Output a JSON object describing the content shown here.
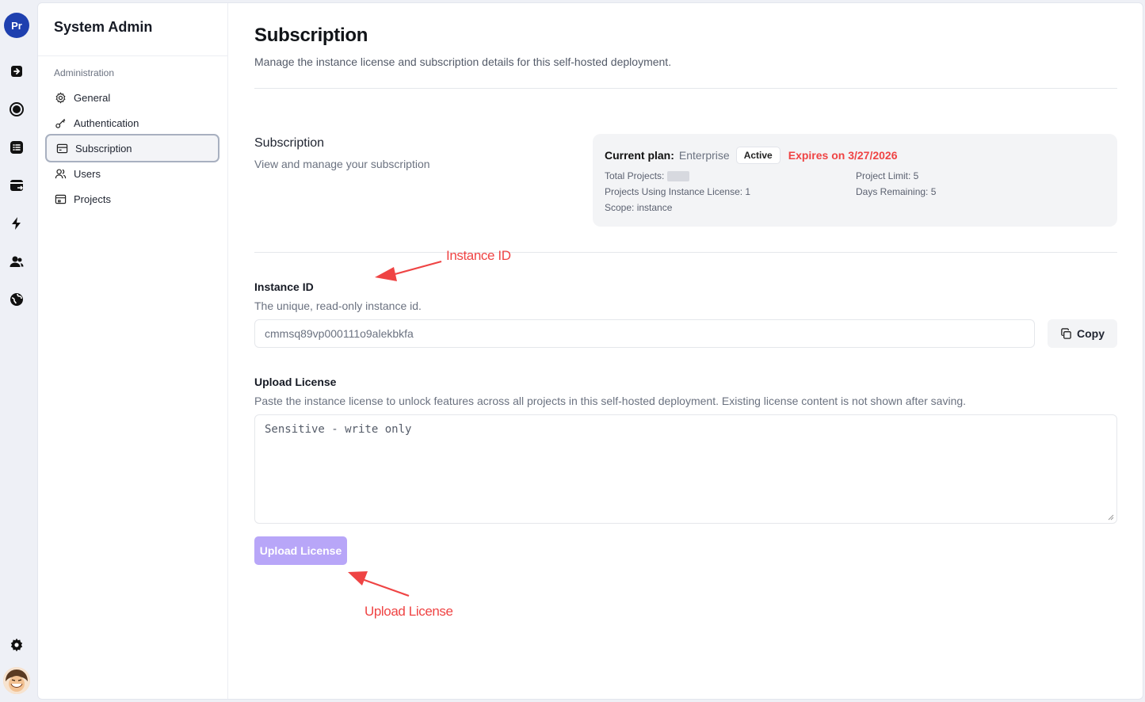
{
  "rail": {
    "workspace_initials": "Pr",
    "icons": [
      "import-icon",
      "record-icon",
      "list-icon",
      "export-icon",
      "bolt-icon",
      "team-icon",
      "globe-icon"
    ],
    "settings_icon": "gear-icon"
  },
  "sidebar": {
    "title": "System Admin",
    "section_label": "Administration",
    "items": [
      {
        "label": "General",
        "icon": "gear-icon",
        "active": false
      },
      {
        "label": "Authentication",
        "icon": "key-icon",
        "active": false
      },
      {
        "label": "Subscription",
        "icon": "card-icon",
        "active": true
      },
      {
        "label": "Users",
        "icon": "users-icon",
        "active": false
      },
      {
        "label": "Projects",
        "icon": "folder-icon",
        "active": false
      }
    ]
  },
  "page": {
    "title": "Subscription",
    "description": "Manage the instance license and subscription details for this self-hosted deployment."
  },
  "subscription": {
    "title": "Subscription",
    "description": "View and manage your subscription",
    "plan_label": "Current plan:",
    "plan_value": "Enterprise",
    "status_badge": "Active",
    "expires": "Expires on 3/27/2026",
    "total_projects_label": "Total Projects:",
    "projects_using_license": "Projects Using Instance License: 1",
    "scope": "Scope: instance",
    "project_limit": "Project Limit: 5",
    "days_remaining": "Days Remaining: 5"
  },
  "instance": {
    "label": "Instance ID",
    "description": "The unique, read-only instance id.",
    "value": "cmmsq89vp000111o9alekbkfa",
    "copy_label": "Copy"
  },
  "license": {
    "label": "Upload License",
    "description": "Paste the instance license to unlock features across all projects in this self-hosted deployment. Existing license content is not shown after saving.",
    "placeholder": "Sensitive - write only",
    "button_label": "Upload License"
  },
  "annotations": {
    "instance_id": "Instance ID",
    "upload_license": "Upload License"
  },
  "colors": {
    "accent_disabled": "#b8a6f8",
    "annotation": "#ef4444",
    "expires": "#ef4444"
  }
}
